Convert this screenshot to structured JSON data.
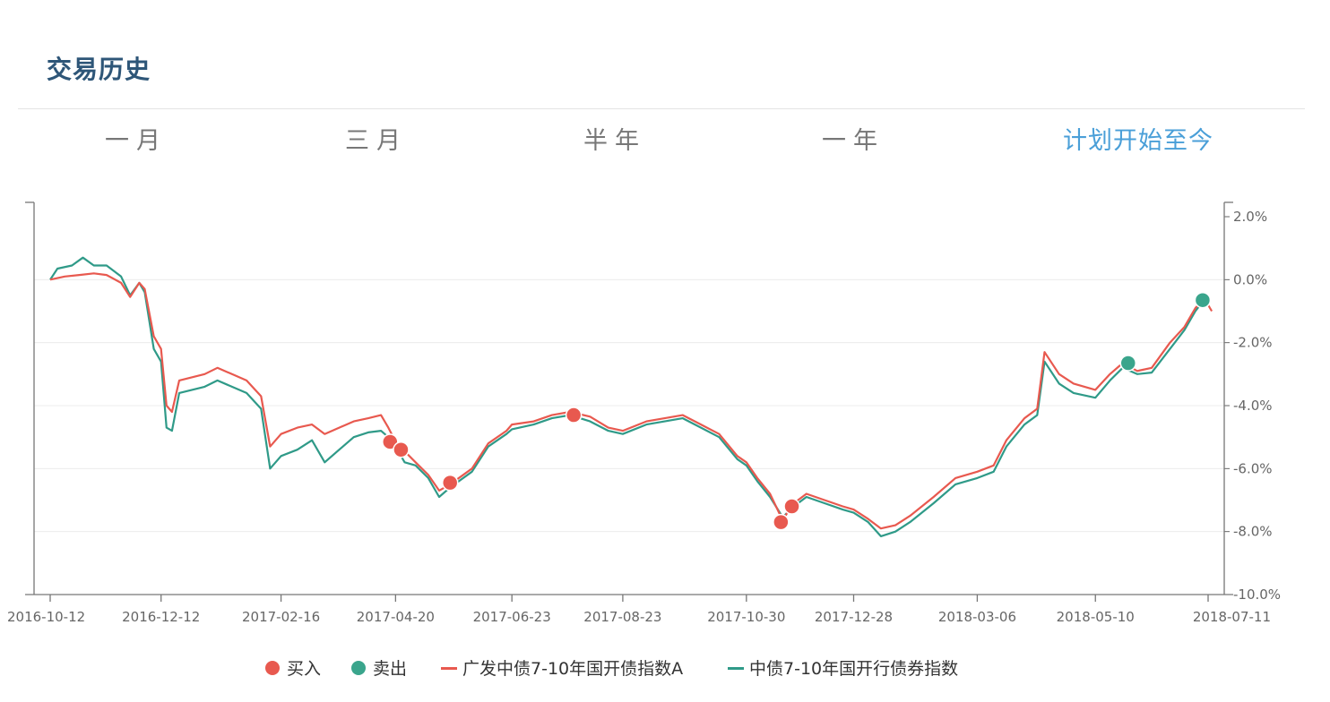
{
  "header": {
    "title": "交易历史"
  },
  "tabs": [
    {
      "label": "一月",
      "active": false
    },
    {
      "label": "三月",
      "active": false
    },
    {
      "label": "半年",
      "active": false
    },
    {
      "label": "一年",
      "active": false
    },
    {
      "label": "计划开始至今",
      "active": true
    }
  ],
  "colors": {
    "buy": "#e8594f",
    "sell": "#3aa58c",
    "fund_line": "#e8594f",
    "index_line": "#2f9a88",
    "active_tab": "#4a9fd8"
  },
  "chart_data": {
    "type": "line",
    "x_tick_labels": [
      "2016-10-12",
      "2016-12-12",
      "2017-02-16",
      "2017-04-20",
      "2017-06-23",
      "2017-08-23",
      "2017-10-30",
      "2017-12-28",
      "2018-03-06",
      "2018-05-10",
      "2018-07-11"
    ],
    "y_tick_labels": [
      "2.0%",
      "0.0%",
      "-2.0%",
      "-4.0%",
      "-6.0%",
      "-8.0%",
      "-10.0%"
    ],
    "ylim": [
      -10.0,
      2.0
    ],
    "grid": true,
    "legend_position": "bottom",
    "legend": [
      {
        "name": "买入",
        "kind": "dot",
        "color": "#e8594f"
      },
      {
        "name": "卖出",
        "kind": "dot",
        "color": "#3aa58c"
      },
      {
        "name": "广发中债7-10年国开债指数A",
        "kind": "line",
        "color": "#e8594f"
      },
      {
        "name": "中债7-10年国开行债券指数",
        "kind": "line",
        "color": "#2f9a88"
      }
    ],
    "series": [
      {
        "name": "广发中债7-10年国开债指数A",
        "color": "#e8594f",
        "points": [
          [
            "2016-10-12",
            0.0
          ],
          [
            "2016-10-20",
            0.1
          ],
          [
            "2016-10-28",
            0.15
          ],
          [
            "2016-11-05",
            0.2
          ],
          [
            "2016-11-12",
            0.15
          ],
          [
            "2016-11-20",
            -0.1
          ],
          [
            "2016-11-25",
            -0.55
          ],
          [
            "2016-11-30",
            -0.1
          ],
          [
            "2016-12-03",
            -0.3
          ],
          [
            "2016-12-08",
            -1.8
          ],
          [
            "2016-12-12",
            -2.2
          ],
          [
            "2016-12-15",
            -4.0
          ],
          [
            "2016-12-18",
            -4.2
          ],
          [
            "2016-12-22",
            -3.2
          ],
          [
            "2017-01-05",
            -3.0
          ],
          [
            "2017-01-12",
            -2.8
          ],
          [
            "2017-01-20",
            -3.0
          ],
          [
            "2017-01-28",
            -3.2
          ],
          [
            "2017-02-05",
            -3.7
          ],
          [
            "2017-02-10",
            -5.3
          ],
          [
            "2017-02-16",
            -4.9
          ],
          [
            "2017-02-25",
            -4.7
          ],
          [
            "2017-03-05",
            -4.6
          ],
          [
            "2017-03-12",
            -4.9
          ],
          [
            "2017-03-20",
            -4.7
          ],
          [
            "2017-03-28",
            -4.5
          ],
          [
            "2017-04-05",
            -4.4
          ],
          [
            "2017-04-12",
            -4.3
          ],
          [
            "2017-04-16",
            -4.7
          ],
          [
            "2017-04-20",
            -5.15
          ],
          [
            "2017-04-25",
            -5.45
          ],
          [
            "2017-05-01",
            -5.8
          ],
          [
            "2017-05-08",
            -6.2
          ],
          [
            "2017-05-14",
            -6.7
          ],
          [
            "2017-05-20",
            -6.5
          ],
          [
            "2017-06-01",
            -6.0
          ],
          [
            "2017-06-10",
            -5.2
          ],
          [
            "2017-06-20",
            -4.8
          ],
          [
            "2017-06-23",
            -4.6
          ],
          [
            "2017-07-05",
            -4.5
          ],
          [
            "2017-07-15",
            -4.3
          ],
          [
            "2017-07-25",
            -4.2
          ],
          [
            "2017-08-05",
            -4.35
          ],
          [
            "2017-08-15",
            -4.7
          ],
          [
            "2017-08-23",
            -4.8
          ],
          [
            "2017-09-05",
            -4.5
          ],
          [
            "2017-09-15",
            -4.4
          ],
          [
            "2017-09-25",
            -4.3
          ],
          [
            "2017-10-05",
            -4.6
          ],
          [
            "2017-10-15",
            -4.9
          ],
          [
            "2017-10-25",
            -5.6
          ],
          [
            "2017-10-30",
            -5.8
          ],
          [
            "2017-11-05",
            -6.3
          ],
          [
            "2017-11-12",
            -6.8
          ],
          [
            "2017-11-19",
            -7.65
          ],
          [
            "2017-11-24",
            -7.15
          ],
          [
            "2017-12-02",
            -6.8
          ],
          [
            "2017-12-12",
            -7.0
          ],
          [
            "2017-12-22",
            -7.2
          ],
          [
            "2017-12-28",
            -7.3
          ],
          [
            "2018-01-05",
            -7.6
          ],
          [
            "2018-01-12",
            -7.9
          ],
          [
            "2018-01-20",
            -7.8
          ],
          [
            "2018-01-28",
            -7.5
          ],
          [
            "2018-02-10",
            -6.9
          ],
          [
            "2018-02-22",
            -6.3
          ],
          [
            "2018-03-06",
            -6.1
          ],
          [
            "2018-03-15",
            -5.9
          ],
          [
            "2018-03-22",
            -5.1
          ],
          [
            "2018-04-01",
            -4.4
          ],
          [
            "2018-04-08",
            -4.1
          ],
          [
            "2018-04-12",
            -2.3
          ],
          [
            "2018-04-20",
            -3.0
          ],
          [
            "2018-04-28",
            -3.3
          ],
          [
            "2018-05-10",
            -3.5
          ],
          [
            "2018-05-18",
            -3.0
          ],
          [
            "2018-05-25",
            -2.65
          ],
          [
            "2018-06-02",
            -2.9
          ],
          [
            "2018-06-10",
            -2.8
          ],
          [
            "2018-06-20",
            -2.0
          ],
          [
            "2018-06-28",
            -1.5
          ],
          [
            "2018-07-04",
            -0.9
          ],
          [
            "2018-07-08",
            -0.65
          ],
          [
            "2018-07-11",
            -0.8
          ],
          [
            "2018-07-13",
            -1.0
          ]
        ]
      },
      {
        "name": "中债7-10年国开行债券指数",
        "color": "#2f9a88",
        "points": [
          [
            "2016-10-12",
            0.0
          ],
          [
            "2016-10-16",
            0.35
          ],
          [
            "2016-10-24",
            0.45
          ],
          [
            "2016-10-30",
            0.7
          ],
          [
            "2016-11-05",
            0.45
          ],
          [
            "2016-11-12",
            0.45
          ],
          [
            "2016-11-20",
            0.1
          ],
          [
            "2016-11-25",
            -0.5
          ],
          [
            "2016-11-30",
            -0.1
          ],
          [
            "2016-12-03",
            -0.4
          ],
          [
            "2016-12-08",
            -2.2
          ],
          [
            "2016-12-12",
            -2.6
          ],
          [
            "2016-12-15",
            -4.7
          ],
          [
            "2016-12-18",
            -4.8
          ],
          [
            "2016-12-22",
            -3.6
          ],
          [
            "2017-01-05",
            -3.4
          ],
          [
            "2017-01-12",
            -3.2
          ],
          [
            "2017-01-20",
            -3.4
          ],
          [
            "2017-01-28",
            -3.6
          ],
          [
            "2017-02-05",
            -4.1
          ],
          [
            "2017-02-10",
            -6.0
          ],
          [
            "2017-02-16",
            -5.6
          ],
          [
            "2017-02-25",
            -5.4
          ],
          [
            "2017-03-05",
            -5.1
          ],
          [
            "2017-03-12",
            -5.8
          ],
          [
            "2017-03-20",
            -5.4
          ],
          [
            "2017-03-28",
            -5.0
          ],
          [
            "2017-04-05",
            -4.85
          ],
          [
            "2017-04-12",
            -4.8
          ],
          [
            "2017-04-16",
            -5.0
          ],
          [
            "2017-04-20",
            -5.3
          ],
          [
            "2017-04-25",
            -5.8
          ],
          [
            "2017-05-01",
            -5.9
          ],
          [
            "2017-05-08",
            -6.3
          ],
          [
            "2017-05-14",
            -6.9
          ],
          [
            "2017-05-20",
            -6.6
          ],
          [
            "2017-06-01",
            -6.1
          ],
          [
            "2017-06-10",
            -5.3
          ],
          [
            "2017-06-20",
            -4.9
          ],
          [
            "2017-06-23",
            -4.75
          ],
          [
            "2017-07-05",
            -4.6
          ],
          [
            "2017-07-15",
            -4.4
          ],
          [
            "2017-07-25",
            -4.3
          ],
          [
            "2017-08-05",
            -4.5
          ],
          [
            "2017-08-15",
            -4.8
          ],
          [
            "2017-08-23",
            -4.9
          ],
          [
            "2017-09-05",
            -4.6
          ],
          [
            "2017-09-15",
            -4.5
          ],
          [
            "2017-09-25",
            -4.4
          ],
          [
            "2017-10-05",
            -4.7
          ],
          [
            "2017-10-15",
            -5.0
          ],
          [
            "2017-10-25",
            -5.7
          ],
          [
            "2017-10-30",
            -5.9
          ],
          [
            "2017-11-05",
            -6.4
          ],
          [
            "2017-11-12",
            -6.9
          ],
          [
            "2017-11-19",
            -7.55
          ],
          [
            "2017-11-24",
            -7.25
          ],
          [
            "2017-12-02",
            -6.9
          ],
          [
            "2017-12-12",
            -7.1
          ],
          [
            "2017-12-22",
            -7.3
          ],
          [
            "2017-12-28",
            -7.4
          ],
          [
            "2018-01-05",
            -7.7
          ],
          [
            "2018-01-12",
            -8.15
          ],
          [
            "2018-01-20",
            -8.0
          ],
          [
            "2018-01-28",
            -7.7
          ],
          [
            "2018-02-10",
            -7.1
          ],
          [
            "2018-02-22",
            -6.5
          ],
          [
            "2018-03-06",
            -6.3
          ],
          [
            "2018-03-15",
            -6.1
          ],
          [
            "2018-03-22",
            -5.3
          ],
          [
            "2018-04-01",
            -4.6
          ],
          [
            "2018-04-08",
            -4.3
          ],
          [
            "2018-04-12",
            -2.6
          ],
          [
            "2018-04-20",
            -3.3
          ],
          [
            "2018-04-28",
            -3.6
          ],
          [
            "2018-05-10",
            -3.75
          ],
          [
            "2018-05-18",
            -3.2
          ],
          [
            "2018-05-25",
            -2.8
          ],
          [
            "2018-06-02",
            -3.0
          ],
          [
            "2018-06-10",
            -2.95
          ],
          [
            "2018-06-20",
            -2.2
          ],
          [
            "2018-06-28",
            -1.6
          ],
          [
            "2018-07-04",
            -1.0
          ],
          [
            "2018-07-08",
            -0.7
          ]
        ]
      }
    ],
    "buy_points": [
      [
        "2017-04-17",
        -5.15
      ],
      [
        "2017-04-23",
        -5.4
      ],
      [
        "2017-05-20",
        -6.45
      ],
      [
        "2017-07-27",
        -4.3
      ],
      [
        "2017-11-18",
        -7.7
      ],
      [
        "2017-11-24",
        -7.2
      ]
    ],
    "sell_points": [
      [
        "2018-05-28",
        -2.65
      ],
      [
        "2018-07-08",
        -0.65
      ]
    ]
  }
}
